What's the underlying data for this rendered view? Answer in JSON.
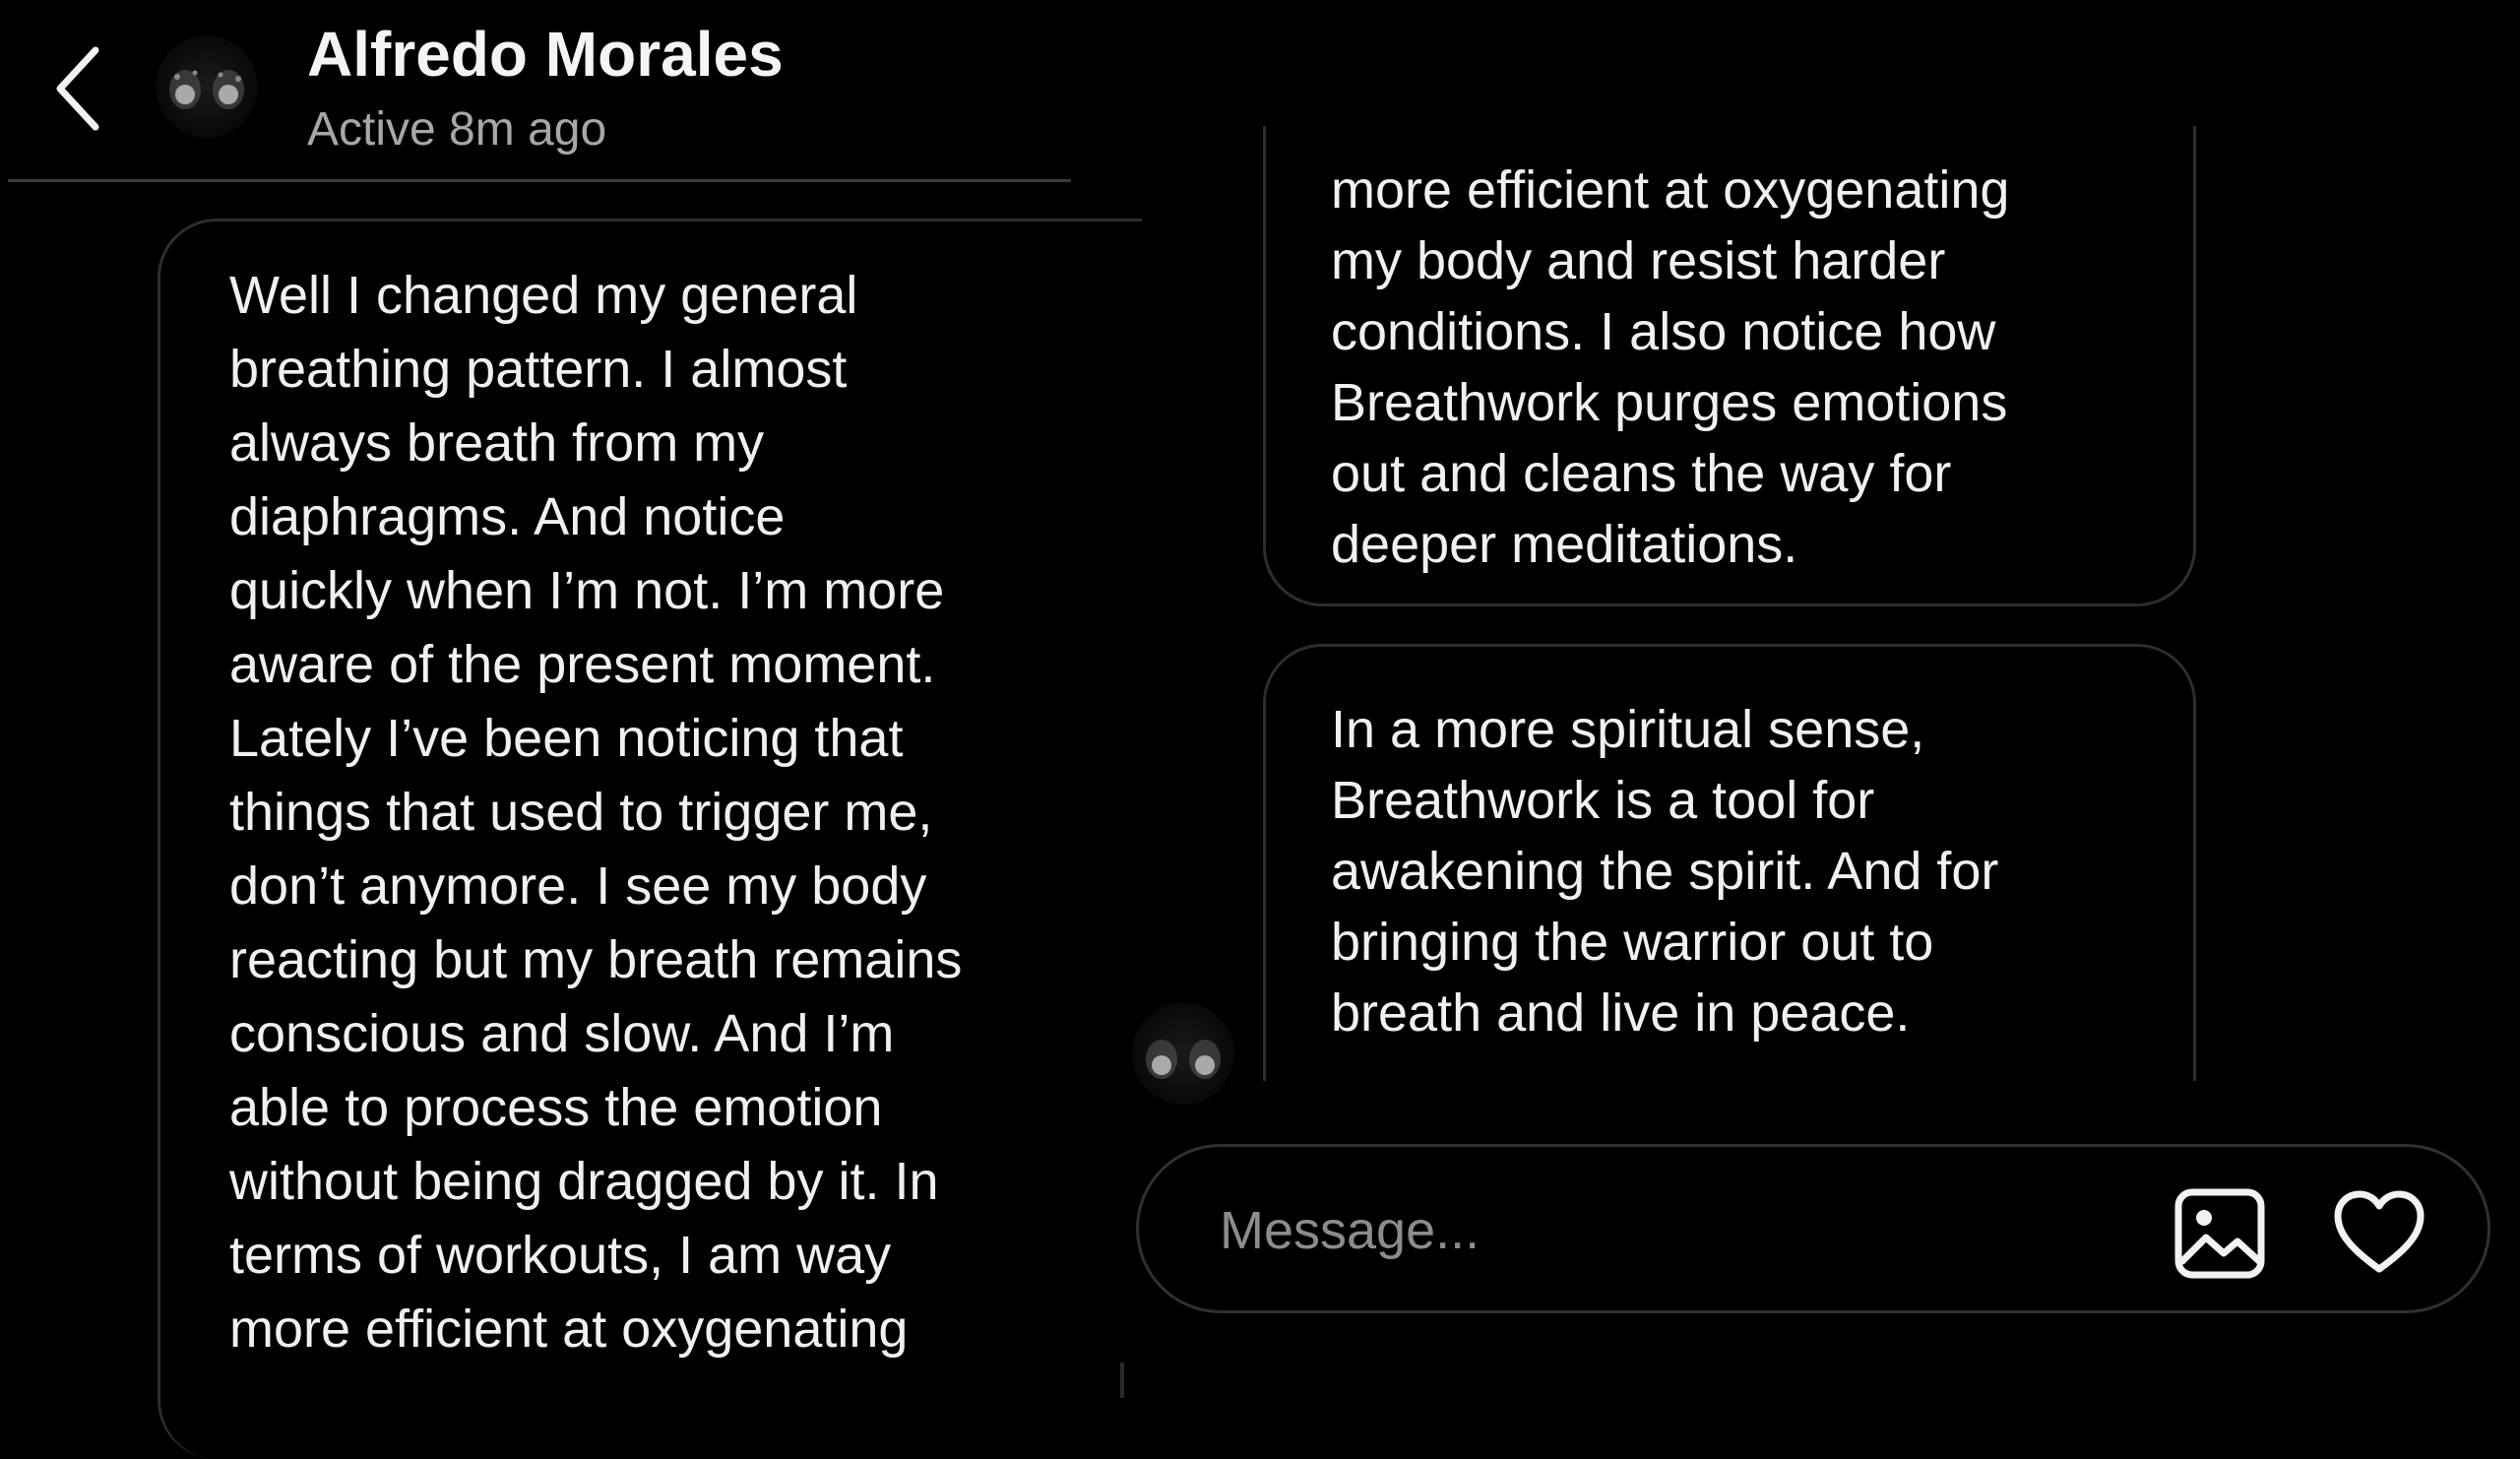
{
  "header": {
    "contact_name": "Alfredo Morales",
    "status": "Active 8m ago",
    "back_icon": "chevron-left-icon",
    "avatar_icon": "avatar"
  },
  "messages": [
    {
      "text": "Well I changed my general\nbreathing pattern. I almost\nalways breath from my\ndiaphragms. And notice\nquickly when I’m not. I’m more\naware of the present moment.\nLately I’ve been noticing that\nthings that used to trigger me,\ndon’t anymore. I see my body\nreacting but my breath remains\nconscious and slow. And I’m\nable to process the emotion\nwithout being dragged by it. In\nterms of workouts, I am way\nmore efficient at oxygenating"
    },
    {
      "text": "more efficient at oxygenating\nmy body and resist harder\nconditions. I also notice how\nBreathwork purges emotions\nout and cleans the way for\ndeeper meditations."
    },
    {
      "text": "In a more spiritual sense,\nBreathwork is a tool for\nawakening the spirit. And for\nbringing the warrior out to\nbreath and live in peace."
    }
  ],
  "composer": {
    "placeholder": "Message...",
    "value": "",
    "gallery_icon": "image-icon",
    "like_icon": "heart-icon"
  },
  "colors": {
    "background": "#000000",
    "text": "#f0f0f0",
    "muted": "#a7a7a7",
    "bubble_border": "#2d2d2d",
    "placeholder": "#8c8c8c"
  }
}
